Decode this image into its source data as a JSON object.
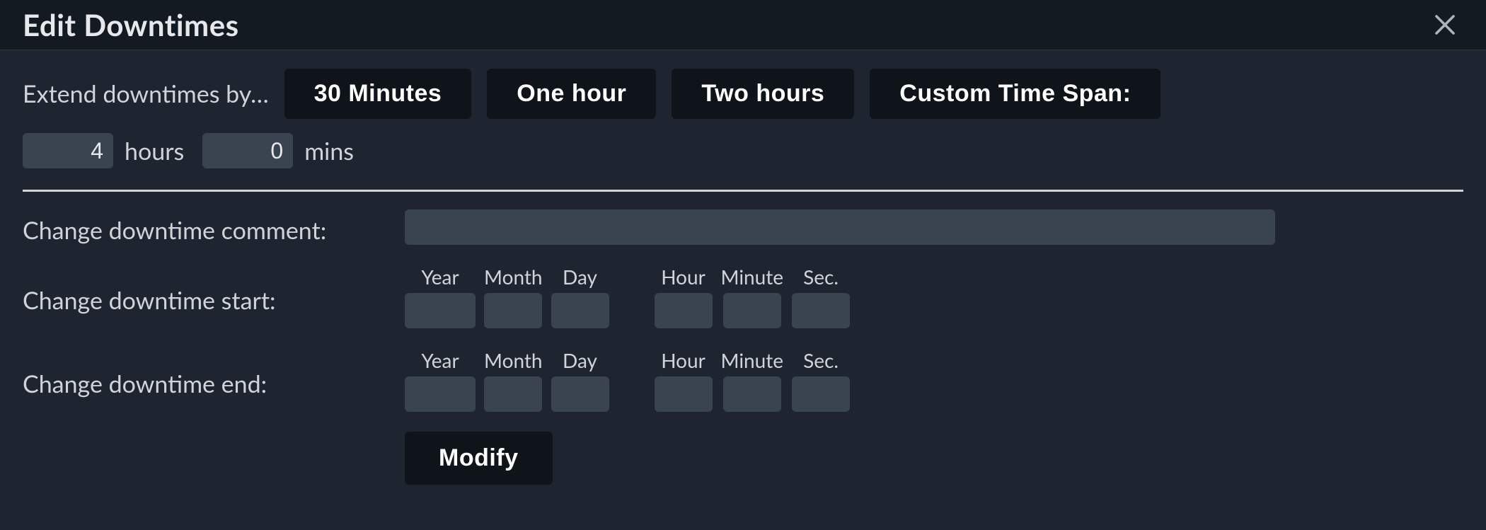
{
  "dialog": {
    "title": "Edit Downtimes"
  },
  "extend": {
    "label": "Extend downtimes by…",
    "buttons": {
      "thirty": "30 Minutes",
      "onehour": "One hour",
      "twohours": "Two hours",
      "custom": "Custom Time Span:"
    },
    "custom": {
      "hours_value": "4",
      "hours_unit": "hours",
      "mins_value": "0",
      "mins_unit": "mins"
    }
  },
  "form": {
    "comment_label": "Change downtime comment:",
    "comment_value": "",
    "start_label": "Change downtime start:",
    "end_label": "Change downtime end:",
    "headers": {
      "year": "Year",
      "month": "Month",
      "day": "Day",
      "hour": "Hour",
      "minute": "Minute",
      "sec": "Sec."
    },
    "start": {
      "year": "",
      "month": "",
      "day": "",
      "hour": "",
      "minute": "",
      "sec": ""
    },
    "end": {
      "year": "",
      "month": "",
      "day": "",
      "hour": "",
      "minute": "",
      "sec": ""
    },
    "submit": "Modify"
  }
}
